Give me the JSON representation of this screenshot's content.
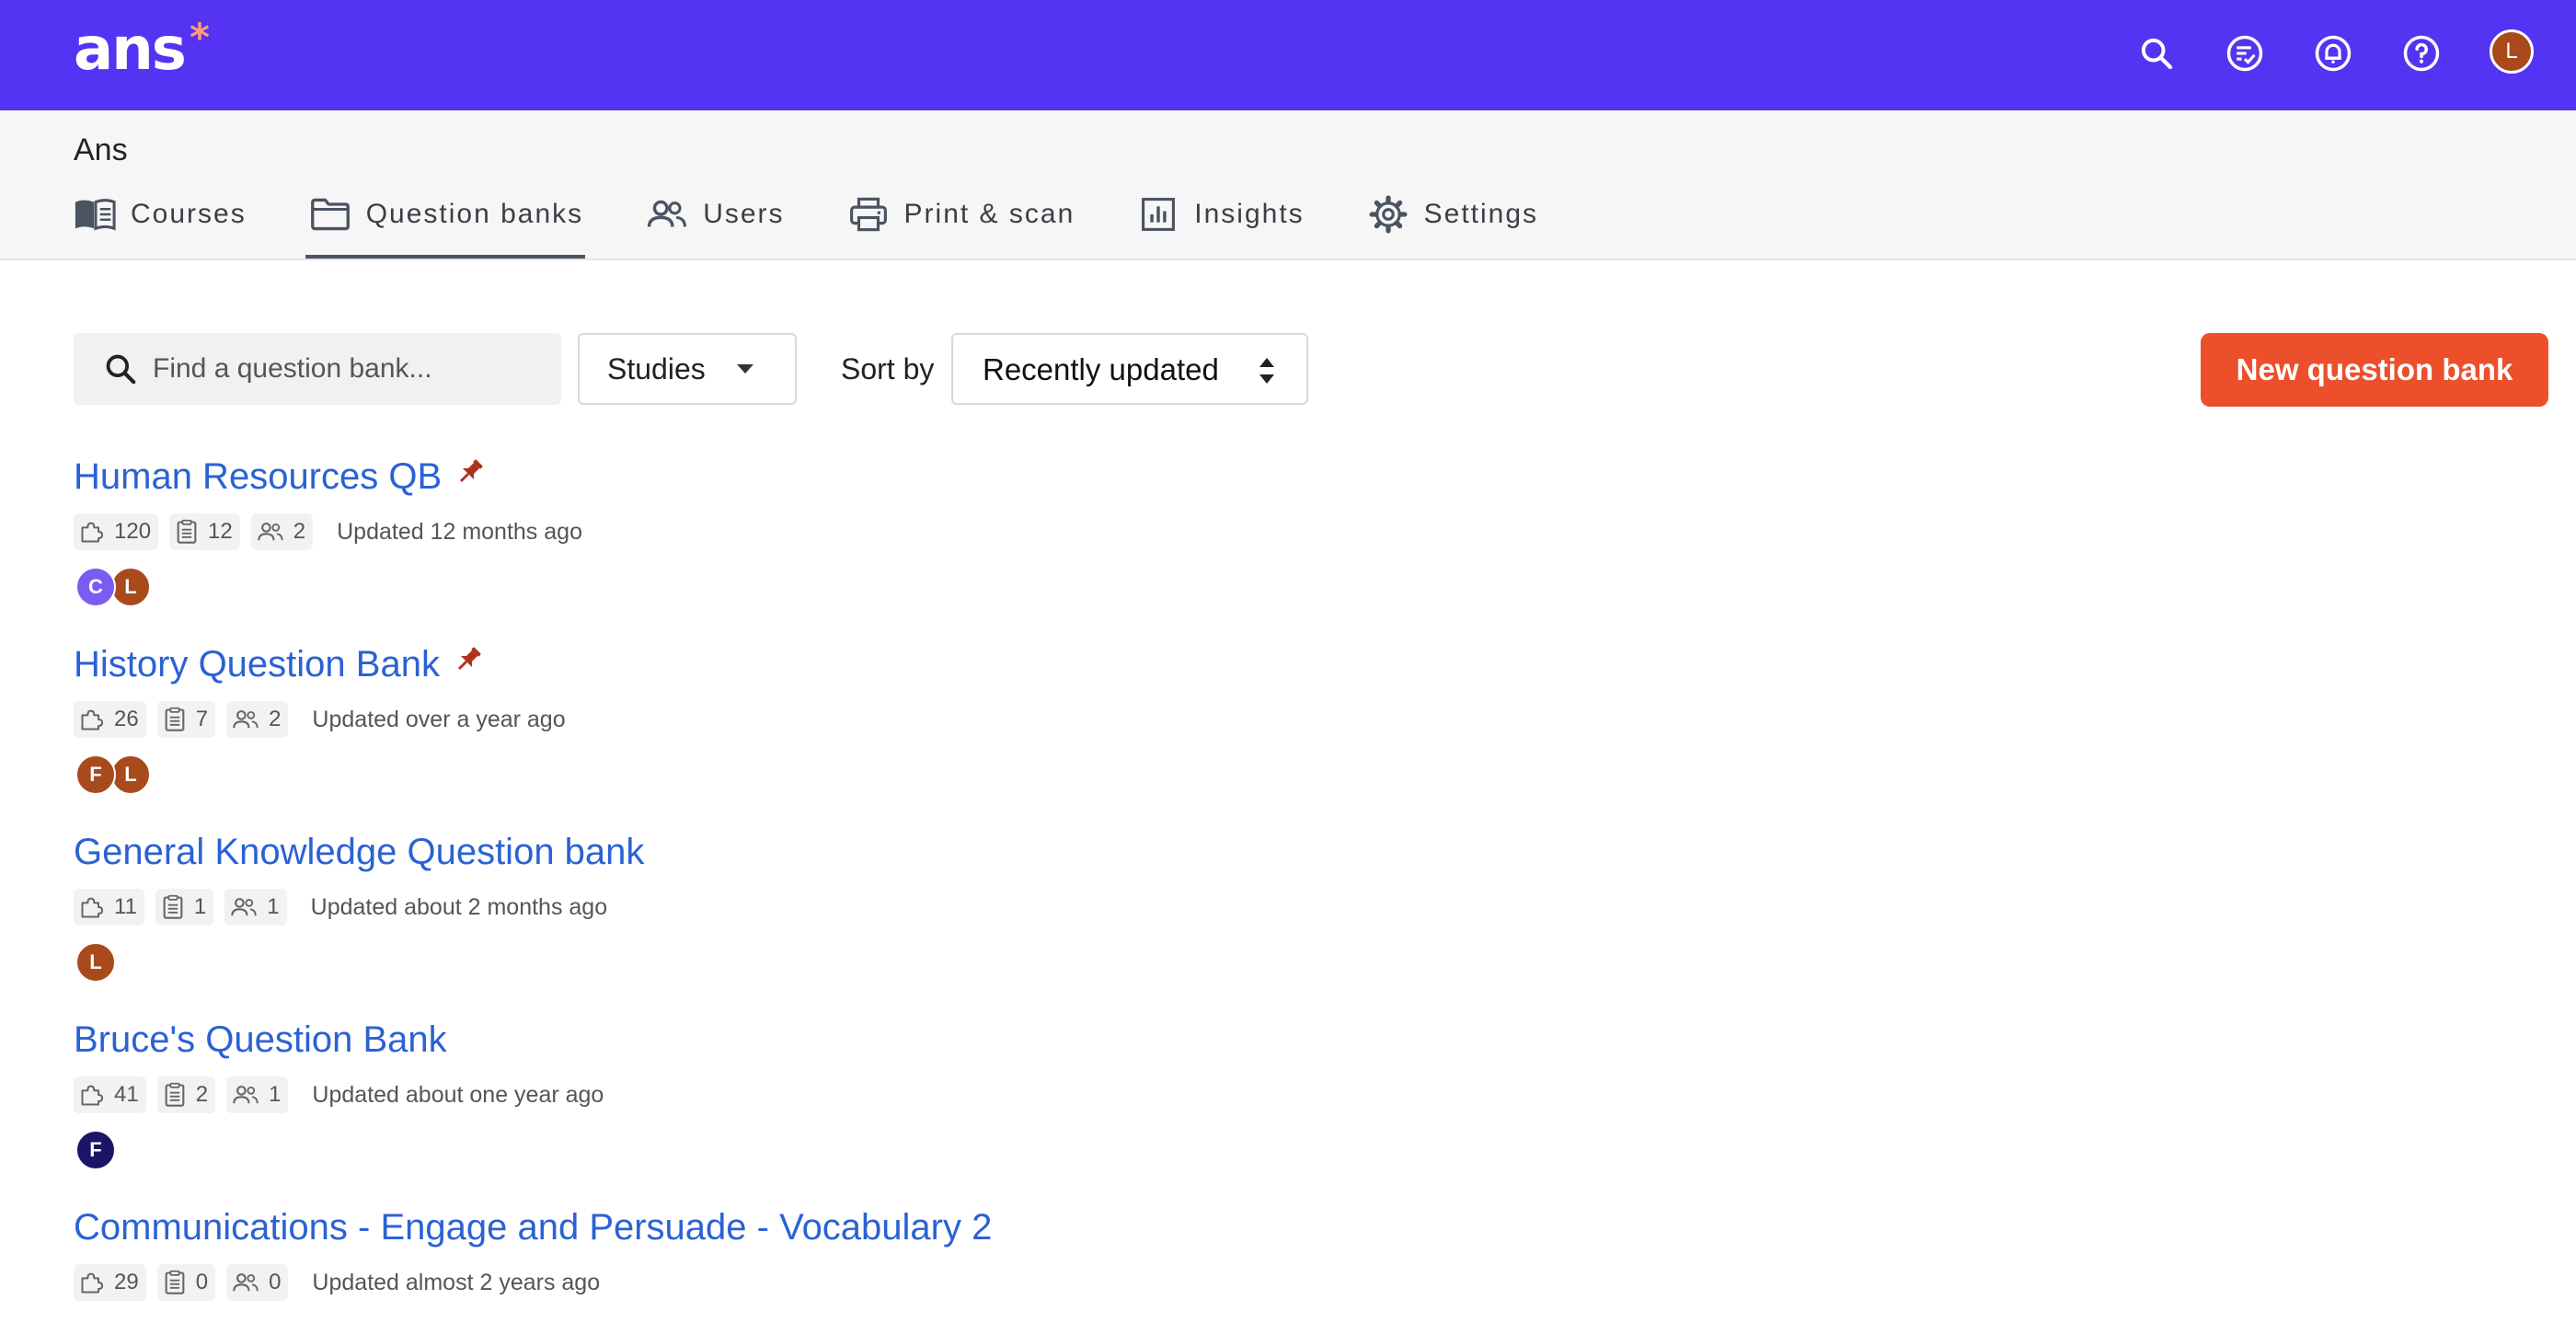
{
  "brand": {
    "logo_text": "ans",
    "logo_star": "*"
  },
  "topbar": {
    "icons": [
      "search-icon",
      "task-check-icon",
      "bell-icon",
      "help-icon"
    ],
    "user_initial": "L"
  },
  "org_name": "Ans",
  "nav": [
    {
      "label": "Courses",
      "icon": "book-icon",
      "active": false
    },
    {
      "label": "Question banks",
      "icon": "folder-icon",
      "active": true
    },
    {
      "label": "Users",
      "icon": "users-icon",
      "active": false
    },
    {
      "label": "Print & scan",
      "icon": "printer-icon",
      "active": false
    },
    {
      "label": "Insights",
      "icon": "chart-icon",
      "active": false
    },
    {
      "label": "Settings",
      "icon": "gear-icon",
      "active": false
    }
  ],
  "toolbar": {
    "search_placeholder": "Find a question bank...",
    "filter_label": "Studies",
    "sort_by_label": "Sort by",
    "sort_value": "Recently updated",
    "new_button": "New question bank"
  },
  "banks": [
    {
      "title": "Human Resources QB",
      "pinned": true,
      "questions": "120",
      "assessments": "12",
      "members": "2",
      "updated": "Updated 12 months ago",
      "avatars": [
        {
          "initial": "C",
          "color": "#7b5cf0"
        },
        {
          "initial": "L",
          "color": "#a84a1c"
        }
      ]
    },
    {
      "title": "History Question Bank",
      "pinned": true,
      "questions": "26",
      "assessments": "7",
      "members": "2",
      "updated": "Updated over a year ago",
      "avatars": [
        {
          "initial": "F",
          "color": "#a84a1c"
        },
        {
          "initial": "L",
          "color": "#a84a1c"
        }
      ]
    },
    {
      "title": "General Knowledge Question bank",
      "pinned": false,
      "questions": "11",
      "assessments": "1",
      "members": "1",
      "updated": "Updated about 2 months ago",
      "avatars": [
        {
          "initial": "L",
          "color": "#a84a1c"
        }
      ]
    },
    {
      "title": "Bruce's Question Bank",
      "pinned": false,
      "questions": "41",
      "assessments": "2",
      "members": "1",
      "updated": "Updated about one year ago",
      "avatars": [
        {
          "initial": "F",
          "color": "#1c1466"
        }
      ]
    },
    {
      "title": "Communications - Engage and Persuade - Vocabulary 2",
      "pinned": false,
      "questions": "29",
      "assessments": "0",
      "members": "0",
      "updated": "Updated almost 2 years ago",
      "avatars": []
    }
  ],
  "colors": {
    "brand": "#5533f2",
    "accent": "#ec4f2b",
    "link": "#2a62d4",
    "pin": "#b0301e"
  }
}
